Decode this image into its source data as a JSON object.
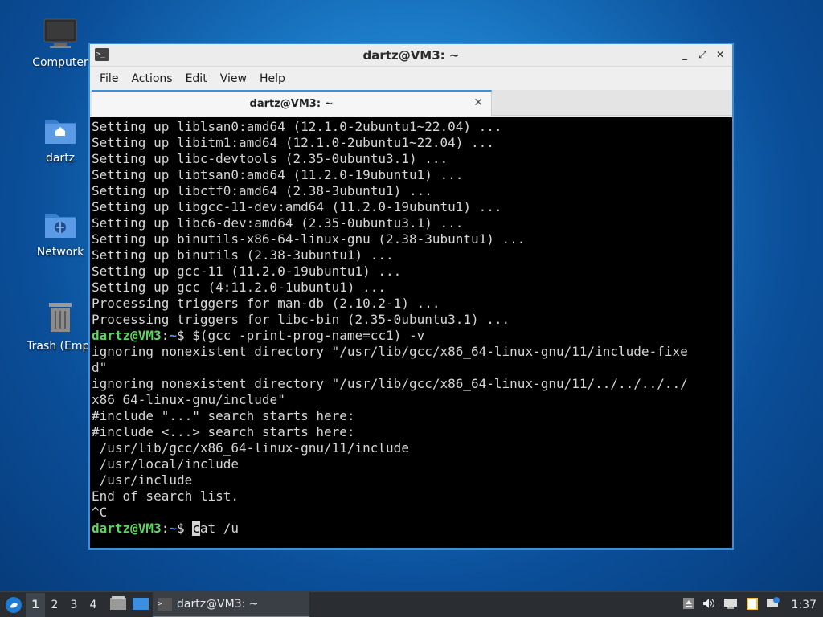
{
  "desktop": {
    "icons": [
      {
        "label": "Computer"
      },
      {
        "label": "dartz"
      },
      {
        "label": "Network"
      },
      {
        "label": "Trash (Empt"
      }
    ]
  },
  "window": {
    "title": "dartz@VM3: ~",
    "buttons": {
      "minimize": "_",
      "maximize": "⤢",
      "close": "✕"
    },
    "menu": [
      "File",
      "Actions",
      "Edit",
      "View",
      "Help"
    ],
    "tab": {
      "label": "dartz@VM3: ~",
      "close": "✕"
    }
  },
  "terminal": {
    "lines": [
      "Setting up liblsan0:amd64 (12.1.0-2ubuntu1~22.04) ...",
      "Setting up libitm1:amd64 (12.1.0-2ubuntu1~22.04) ...",
      "Setting up libc-devtools (2.35-0ubuntu3.1) ...",
      "Setting up libtsan0:amd64 (11.2.0-19ubuntu1) ...",
      "Setting up libctf0:amd64 (2.38-3ubuntu1) ...",
      "Setting up libgcc-11-dev:amd64 (11.2.0-19ubuntu1) ...",
      "Setting up libc6-dev:amd64 (2.35-0ubuntu3.1) ...",
      "Setting up binutils-x86-64-linux-gnu (2.38-3ubuntu1) ...",
      "Setting up binutils (2.38-3ubuntu1) ...",
      "Setting up gcc-11 (11.2.0-19ubuntu1) ...",
      "Setting up gcc (4:11.2.0-1ubuntu1) ...",
      "Processing triggers for man-db (2.10.2-1) ...",
      "Processing triggers for libc-bin (2.35-0ubuntu3.1) ..."
    ],
    "prompt_user": "dartz@VM3",
    "prompt_colon": ":",
    "prompt_path": "~",
    "prompt_dollar": "$ ",
    "command1": "$(gcc -print-prog-name=cc1) -v",
    "output_lines": [
      "ignoring nonexistent directory \"/usr/lib/gcc/x86_64-linux-gnu/11/include-fixe",
      "d\"",
      "ignoring nonexistent directory \"/usr/lib/gcc/x86_64-linux-gnu/11/../../../../",
      "x86_64-linux-gnu/include\"",
      "#include \"...\" search starts here:",
      "#include <...> search starts here:",
      " /usr/lib/gcc/x86_64-linux-gnu/11/include",
      " /usr/local/include",
      " /usr/include",
      "End of search list.",
      "^C"
    ],
    "current_input_cursor": "c",
    "current_input_rest": "at /u"
  },
  "taskbar": {
    "workspaces": [
      "1",
      "2",
      "3",
      "4"
    ],
    "active_workspace": "1",
    "task_label": "dartz@VM3: ~",
    "clock": "1:37"
  }
}
